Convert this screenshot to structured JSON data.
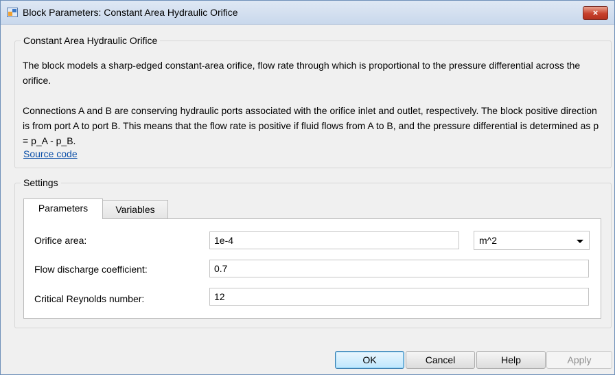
{
  "window": {
    "title": "Block Parameters: Constant Area Hydraulic Orifice",
    "close_label": "×"
  },
  "description": {
    "legend": "Constant Area Hydraulic Orifice",
    "para1": "The block models a sharp-edged constant-area orifice, flow rate through which is proportional to the pressure differential across the orifice.",
    "para2": "Connections A and B are conserving hydraulic ports associated with the orifice inlet and outlet, respectively. The block positive direction is from port A to port B. This means that the flow rate is positive if fluid flows from A to B, and the pressure differential is determined as p = p_A - p_B.",
    "source_link": "Source code"
  },
  "settings": {
    "legend": "Settings",
    "tabs": [
      {
        "label": "Parameters",
        "active": true
      },
      {
        "label": "Variables",
        "active": false
      }
    ],
    "params": [
      {
        "label": "Orifice area:",
        "value": "1e-4",
        "unit": "m^2"
      },
      {
        "label": "Flow discharge coefficient:",
        "value": "0.7"
      },
      {
        "label": "Critical Reynolds number:",
        "value": "12"
      }
    ]
  },
  "buttons": {
    "ok": "OK",
    "cancel": "Cancel",
    "help": "Help",
    "apply": "Apply"
  },
  "colors": {
    "link": "#0b4fa8",
    "close": "#c7402c",
    "default_button_border": "#3c7fb1"
  },
  "icons": {
    "app": "simulink-block-icon",
    "close": "close-icon",
    "dropdown": "chevron-down-icon"
  }
}
